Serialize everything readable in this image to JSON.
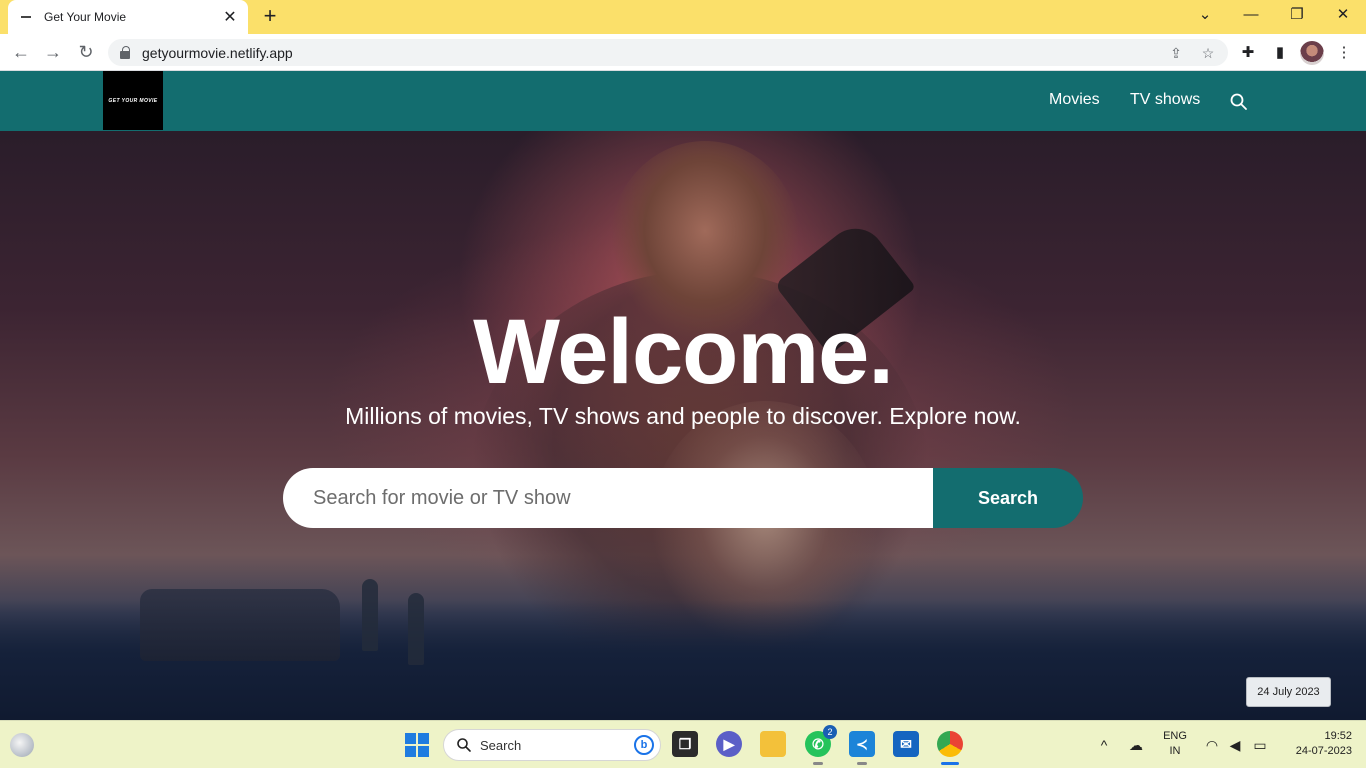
{
  "browser": {
    "tab_title": "Get Your Movie",
    "tab_close": "✕",
    "new_tab": "+",
    "url": "getyourmovie.netlify.app",
    "window_minimize": "—",
    "window_restore": "❐",
    "window_close": "✕",
    "accent": "#fbe06a"
  },
  "site": {
    "logo_text": "GET YOUR MOVIE",
    "nav": {
      "movies": "Movies",
      "tv_shows": "TV shows"
    },
    "brand_color": "#136d6f"
  },
  "hero": {
    "title": "Welcome.",
    "subtitle": "Millions of movies, TV shows and people to discover. Explore now.",
    "search_placeholder": "Search for movie or TV show",
    "search_button": "Search"
  },
  "tooltip": {
    "date": "24 July 2023"
  },
  "taskbar": {
    "search_label": "Search",
    "whatsapp_badge": "2",
    "language_top": "ENG",
    "language_bottom": "IN",
    "time": "19:52",
    "date": "24-07-2023"
  }
}
